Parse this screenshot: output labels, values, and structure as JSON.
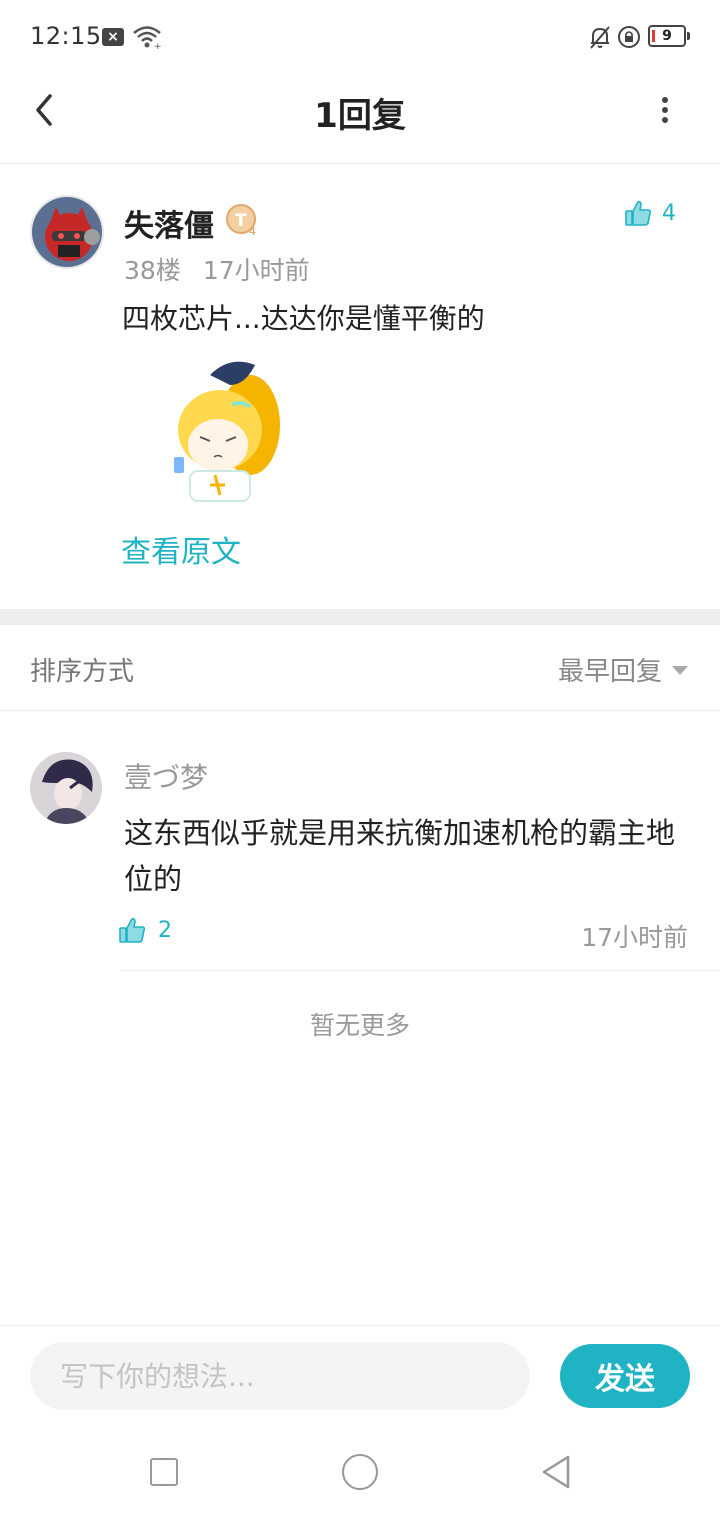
{
  "status_bar": {
    "time": "12:15",
    "battery": "9",
    "icons": [
      "x-notification-icon",
      "wifi-icon",
      "bell-muted-icon",
      "rotation-lock-icon",
      "battery-icon"
    ]
  },
  "header": {
    "title": "1回复",
    "back_icon": "chevron-left-icon",
    "more_icon": "more-vertical-icon"
  },
  "main_comment": {
    "username": "失落僵",
    "level_badge": "T4",
    "likes": "4",
    "floor": "38楼",
    "time": "17小时前",
    "text": "四枚芯片...达达你是懂平衡的",
    "view_original": "查看原文"
  },
  "sort": {
    "label": "排序方式",
    "selected": "最早回复"
  },
  "reply": {
    "username": "壹づ梦",
    "text": "这东西似乎就是用来抗衡加速机枪的霸主地位的",
    "likes": "2",
    "time": "17小时前"
  },
  "no_more": "暂无更多",
  "input": {
    "placeholder": "写下你的想法...",
    "send_label": "发送"
  },
  "colors": {
    "accent": "#1fb3c4",
    "muted_text": "#999999",
    "divider": "#ececec"
  }
}
